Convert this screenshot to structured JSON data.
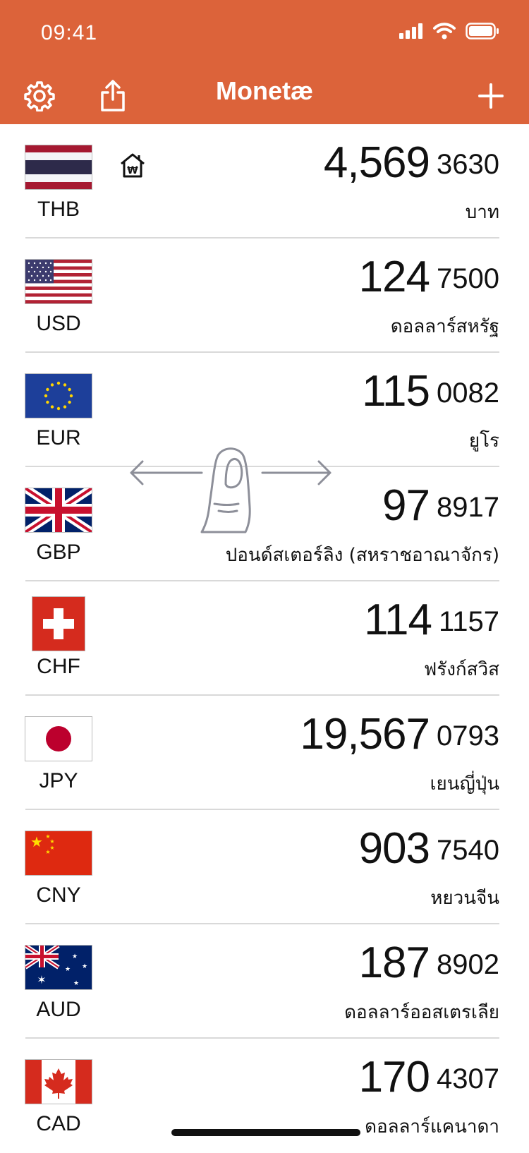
{
  "status_bar": {
    "time": "09:41"
  },
  "header": {
    "title": "Monetæ"
  },
  "currencies": [
    {
      "code": "THB",
      "amount_int": "4,569",
      "amount_frac": "3630",
      "name": "บาท",
      "flag": "thailand-flag",
      "base": true
    },
    {
      "code": "USD",
      "amount_int": "124",
      "amount_frac": "7500",
      "name": "ดอลลาร์สหรัฐ",
      "flag": "usa-flag"
    },
    {
      "code": "EUR",
      "amount_int": "115",
      "amount_frac": "0082",
      "name": "ยูโร",
      "flag": "eu-flag"
    },
    {
      "code": "GBP",
      "amount_int": "97",
      "amount_frac": "8917",
      "name": "ปอนด์สเตอร์ลิง (สหราชอาณาจักร)",
      "flag": "uk-flag"
    },
    {
      "code": "CHF",
      "amount_int": "114",
      "amount_frac": "1157",
      "name": "ฟรังก์สวิส",
      "flag": "switzerland-flag"
    },
    {
      "code": "JPY",
      "amount_int": "19,567",
      "amount_frac": "0793",
      "name": "เยนญี่ปุ่น",
      "flag": "japan-flag"
    },
    {
      "code": "CNY",
      "amount_int": "903",
      "amount_frac": "7540",
      "name": "หยวนจีน",
      "flag": "china-flag"
    },
    {
      "code": "AUD",
      "amount_int": "187",
      "amount_frac": "8902",
      "name": "ดอลลาร์ออสเตรเลีย",
      "flag": "australia-flag"
    },
    {
      "code": "CAD",
      "amount_int": "170",
      "amount_frac": "4307",
      "name": "ดอลลาร์แคนาดา",
      "flag": "canada-flag"
    }
  ],
  "colors": {
    "header": "#dc633a",
    "divider": "#d9d9d9"
  },
  "icons": [
    "gear-icon",
    "share-icon",
    "plus-icon",
    "home-base-icon",
    "swipe-gesture-icon",
    "signal-icon",
    "wifi-icon",
    "battery-icon"
  ]
}
